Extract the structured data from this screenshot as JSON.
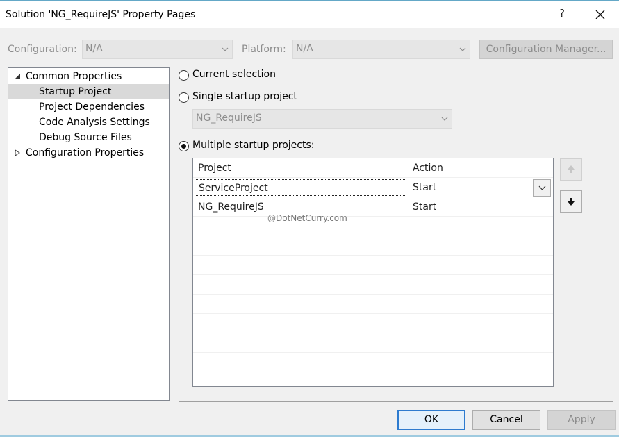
{
  "window": {
    "title": "Solution 'NG_RequireJS' Property Pages",
    "help_glyph": "?"
  },
  "config_row": {
    "configuration_label": "Configuration:",
    "configuration_value": "N/A",
    "platform_label": "Platform:",
    "platform_value": "N/A",
    "config_manager_label": "Configuration Manager..."
  },
  "tree": {
    "items": [
      {
        "label": "Common Properties",
        "expanded": true
      },
      {
        "label": "Startup Project",
        "selected": true
      },
      {
        "label": "Project Dependencies"
      },
      {
        "label": "Code Analysis Settings"
      },
      {
        "label": "Debug Source Files"
      },
      {
        "label": "Configuration Properties",
        "expanded": false
      }
    ]
  },
  "startup": {
    "current_selection_label": "Current selection",
    "single_label": "Single startup project",
    "single_value": "NG_RequireJS",
    "multiple_label": "Multiple startup projects:",
    "selected_option": "multiple"
  },
  "grid": {
    "headers": {
      "project": "Project",
      "action": "Action"
    },
    "rows": [
      {
        "project": "ServiceProject",
        "action": "Start"
      },
      {
        "project": "NG_RequireJS",
        "action": "Start"
      }
    ]
  },
  "watermark": "@DotNetCurry.com",
  "buttons": {
    "ok": "OK",
    "cancel": "Cancel",
    "apply": "Apply"
  },
  "colors": {
    "accent": "#2e7bcf",
    "window_border": "#64a8c7",
    "selection": "#d9d9d9"
  }
}
